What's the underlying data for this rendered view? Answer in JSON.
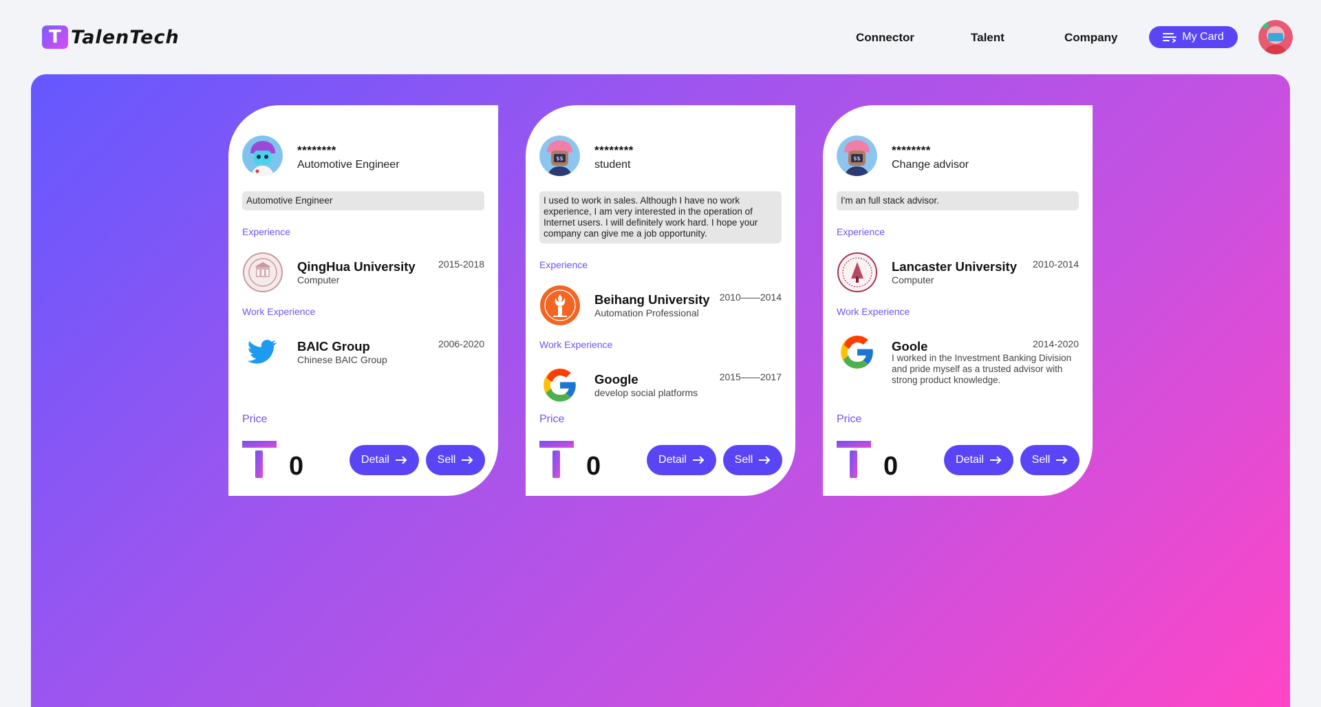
{
  "brand": {
    "logo_letter": "T",
    "name": "TalenTech"
  },
  "nav": {
    "connector": "Connector",
    "talent": "Talent",
    "company": "Company",
    "my_card": "My Card"
  },
  "colors": {
    "accent": "#5a45f6",
    "label": "#6b55f2",
    "gradient_start": "#6458ff",
    "gradient_end": "#ff46c6"
  },
  "cards": [
    {
      "name_masked": "********",
      "title": "Automotive Engineer",
      "bio": "Automotive Engineer",
      "education_label": "Experience",
      "education": {
        "school": "QingHua University",
        "major": "Computer",
        "years": "2015-2018",
        "icon": "university-seal-icon"
      },
      "work_label": "Work Experience",
      "work": {
        "company": "BAIC Group",
        "detail": "Chinese BAIC Group",
        "years": "2006-2020",
        "icon": "twitter-bird-icon"
      },
      "price_label": "Price",
      "price": "0",
      "detail_label": "Detail",
      "sell_label": "Sell"
    },
    {
      "name_masked": "********",
      "title": "student",
      "bio": "I used to work in sales. Although I have no work experience, I am very interested in the operation of Internet users. I will definitely work hard. I hope your company can give me a job opportunity.",
      "education_label": "Experience",
      "education": {
        "school": "Beihang University",
        "major": "Automation Professional",
        "years": "2010——2014",
        "icon": "university-torch-icon"
      },
      "work_label": "Work Experience",
      "work": {
        "company": "Google",
        "detail": "develop social platforms",
        "years": "2015——2017",
        "icon": "google-g-icon"
      },
      "price_label": "Price",
      "price": "0",
      "detail_label": "Detail",
      "sell_label": "Sell"
    },
    {
      "name_masked": "********",
      "title": "Change advisor",
      "bio": "I'm an full stack advisor.",
      "education_label": "Experience",
      "education": {
        "school": "Lancaster University",
        "major": "Computer",
        "years": "2010-2014",
        "icon": "university-seal-icon"
      },
      "work_label": "Work Experience",
      "work": {
        "company": "Goole",
        "detail": "I worked in the Investment Banking Division and pride myself as a trusted advisor with strong product knowledge.",
        "years": "2014-2020",
        "icon": "google-g-icon"
      },
      "price_label": "Price",
      "price": "0",
      "detail_label": "Detail",
      "sell_label": "Sell"
    }
  ]
}
